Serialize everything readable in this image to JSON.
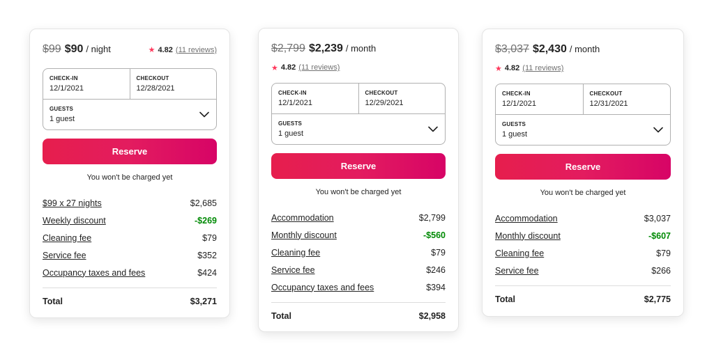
{
  "colors": {
    "accent_start": "#e61e4d",
    "accent_end": "#d70466",
    "star": "#ff385c",
    "discount": "#008a05",
    "muted": "#717171"
  },
  "cards": [
    {
      "old_price": "$99",
      "new_price": "$90",
      "per_unit": "/ night",
      "rating": {
        "star_icon": "star-icon",
        "star": "★",
        "score": "4.82",
        "reviews": "(11 reviews)"
      },
      "checkin": {
        "label": "CHECK-IN",
        "value": "12/1/2021"
      },
      "checkout": {
        "label": "CHECKOUT",
        "value": "12/28/2021"
      },
      "guests": {
        "label": "GUESTS",
        "value": "1 guest",
        "icon": "chevron-down-icon"
      },
      "reserve_label": "Reserve",
      "note": "You won't be charged yet",
      "lines": [
        {
          "label": "$99 x 27 nights",
          "value": "$2,685",
          "discount": false
        },
        {
          "label": "Weekly discount",
          "value": "-$269",
          "discount": true
        },
        {
          "label": "Cleaning fee",
          "value": "$79",
          "discount": false
        },
        {
          "label": "Service fee",
          "value": "$352",
          "discount": false
        },
        {
          "label": "Occupancy taxes and fees",
          "value": "$424",
          "discount": false
        }
      ],
      "total_label": "Total",
      "total_value": "$3,271"
    },
    {
      "old_price": "$2,799",
      "new_price": "$2,239",
      "per_unit": "/ month",
      "rating": {
        "star_icon": "star-icon",
        "star": "★",
        "score": "4.82",
        "reviews": "(11 reviews)"
      },
      "checkin": {
        "label": "CHECK-IN",
        "value": "12/1/2021"
      },
      "checkout": {
        "label": "CHECKOUT",
        "value": "12/29/2021"
      },
      "guests": {
        "label": "GUESTS",
        "value": "1 guest",
        "icon": "chevron-down-icon"
      },
      "reserve_label": "Reserve",
      "note": "You won't be charged yet",
      "lines": [
        {
          "label": "Accommodation",
          "value": "$2,799",
          "discount": false
        },
        {
          "label": "Monthly discount",
          "value": "-$560",
          "discount": true
        },
        {
          "label": "Cleaning fee",
          "value": "$79",
          "discount": false
        },
        {
          "label": "Service fee",
          "value": "$246",
          "discount": false
        },
        {
          "label": "Occupancy taxes and fees",
          "value": "$394",
          "discount": false
        }
      ],
      "total_label": "Total",
      "total_value": "$2,958"
    },
    {
      "old_price": "$3,037",
      "new_price": "$2,430",
      "per_unit": "/ month",
      "rating": {
        "star_icon": "star-icon",
        "star": "★",
        "score": "4.82",
        "reviews": "(11 reviews)"
      },
      "checkin": {
        "label": "CHECK-IN",
        "value": "12/1/2021"
      },
      "checkout": {
        "label": "CHECKOUT",
        "value": "12/31/2021"
      },
      "guests": {
        "label": "GUESTS",
        "value": "1 guest",
        "icon": "chevron-down-icon"
      },
      "reserve_label": "Reserve",
      "note": "You won't be charged yet",
      "lines": [
        {
          "label": "Accommodation",
          "value": "$3,037",
          "discount": false
        },
        {
          "label": "Monthly discount",
          "value": "-$607",
          "discount": true
        },
        {
          "label": "Cleaning fee",
          "value": "$79",
          "discount": false
        },
        {
          "label": "Service fee",
          "value": "$266",
          "discount": false
        }
      ],
      "total_label": "Total",
      "total_value": "$2,775"
    }
  ]
}
